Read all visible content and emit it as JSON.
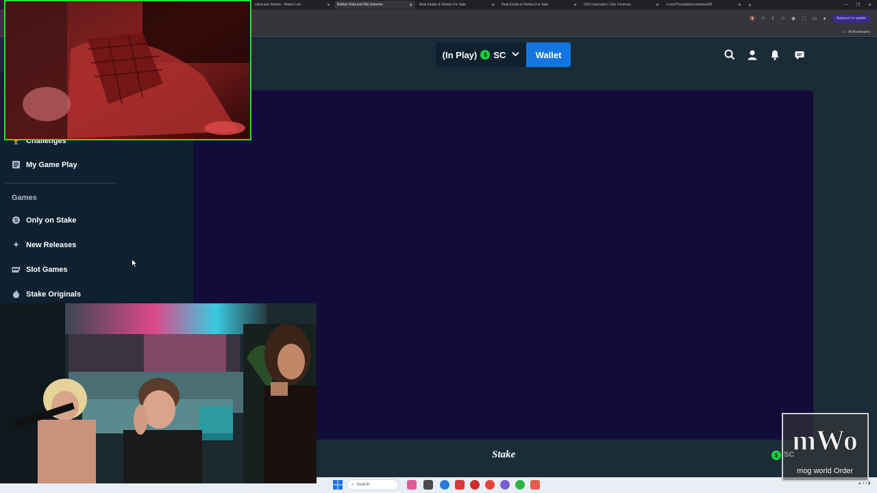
{
  "browser": {
    "tabs": [
      {
        "title": "clavicular Stream - Watch Live",
        "active": false
      },
      {
        "title": "Buffalo Hold and Win Extreme",
        "active": true
      },
      {
        "title": "Real Estate & Homes For Sale",
        "active": false
      },
      {
        "title": "Real Estate & Homes For Sale",
        "active": false
      },
      {
        "title": "(20) Clavicular's Clan Commun",
        "active": false
      },
      {
        "title": "x.com/TrumpElonica/status/20",
        "active": false
      }
    ],
    "relaunch_label": "Relaunch to update",
    "all_bookmarks_label": "All Bookmarks"
  },
  "header": {
    "balance_status": "(In Play)",
    "currency_symbol": "$",
    "currency": "SC",
    "wallet_label": "Wallet",
    "icons": [
      "search-icon",
      "user-icon",
      "bell-icon",
      "chat-icon"
    ]
  },
  "sidebar": {
    "items_top": [
      {
        "label": "Challenges",
        "icon": "trophy-icon"
      },
      {
        "label": "My Game Play",
        "icon": "list-icon"
      }
    ],
    "section_label": "Games",
    "items_games": [
      {
        "label": "Only on Stake",
        "icon": "stake-coin-icon"
      },
      {
        "label": "New Releases",
        "icon": "sparkle-icon"
      },
      {
        "label": "Slot Games",
        "icon": "slot-machine-icon"
      },
      {
        "label": "Stake Originals",
        "icon": "flame-icon"
      }
    ]
  },
  "footer": {
    "logo_text": "Stake",
    "currency_symbol": "$",
    "currency": "SC"
  },
  "taskbar": {
    "search_label": "Search"
  },
  "overlay": {
    "watermark_text": "mWo",
    "watermark_caption": "mog world Order"
  },
  "colors": {
    "brand_blue": "#1475e1",
    "sc_green": "#1fcf3f",
    "header_bg": "#1a2c38",
    "sidebar_bg": "#0f212e",
    "game_bg": "#120c38"
  }
}
